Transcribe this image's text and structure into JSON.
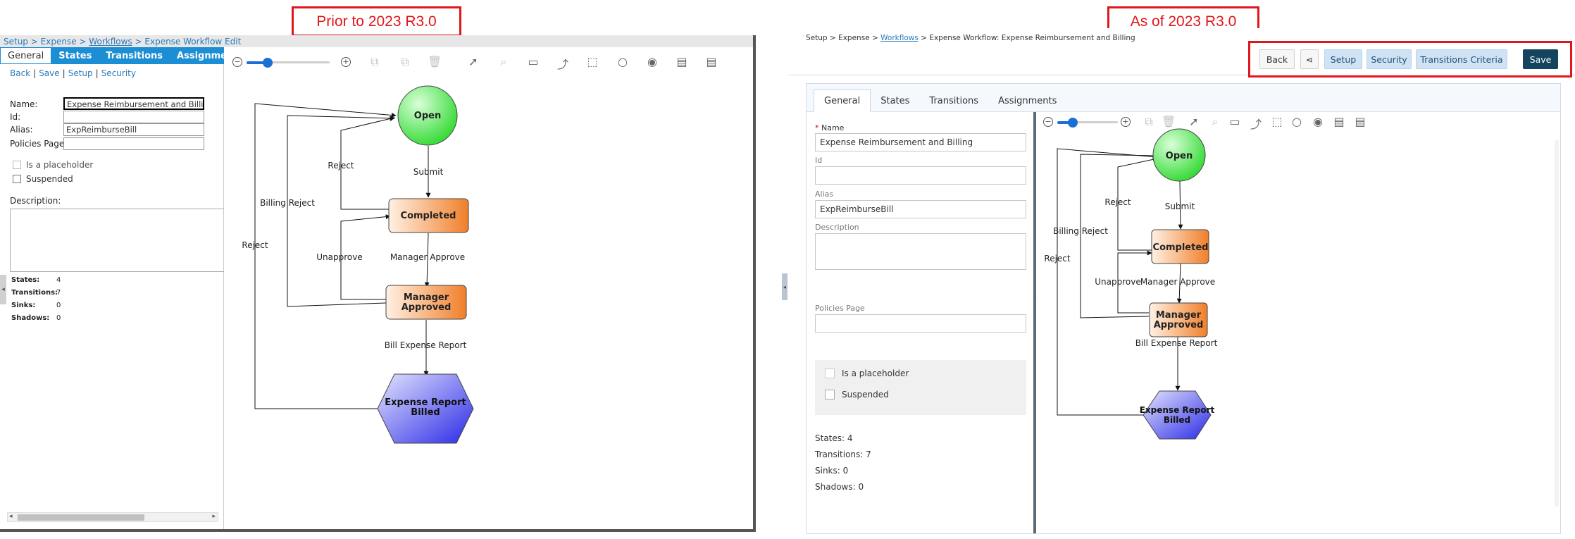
{
  "callouts": {
    "old": "Prior to 2023 R3.0",
    "new": "As of 2023 R3.0"
  },
  "old": {
    "breadcrumb": {
      "setup": "Setup",
      "sep": ">",
      "expense": "Expense",
      "workflows": "Workflows",
      "current": "Expense Workflow Edit"
    },
    "tabs": [
      "General",
      "States",
      "Transitions",
      "Assignments"
    ],
    "actions": [
      "Back",
      "Save",
      "Setup",
      "Security"
    ],
    "fields": {
      "name_label": "Name:",
      "name_value": "Expense Reimbursement and Billing",
      "id_label": "Id:",
      "id_value": "",
      "alias_label": "Alias:",
      "alias_value": "ExpReimburseBill",
      "policies_label": "Policies Page:",
      "policies_value": ""
    },
    "checks": {
      "placeholder": "Is a placeholder",
      "suspended": "Suspended"
    },
    "description_label": "Description:",
    "stats": [
      {
        "label": "States:",
        "value": "4"
      },
      {
        "label": "Transitions:",
        "value": "7"
      },
      {
        "label": "Sinks:",
        "value": "0"
      },
      {
        "label": "Shadows:",
        "value": "0"
      }
    ]
  },
  "new": {
    "breadcrumb": {
      "setup": "Setup",
      "sep": ">",
      "expense": "Expense",
      "workflows": "Workflows",
      "current": "Expense Workflow: Expense Reimbursement and Billing"
    },
    "buttons": {
      "back": "Back",
      "setup": "Setup",
      "security": "Security",
      "transitions_criteria": "Transitions Criteria",
      "save": "Save"
    },
    "tabs": [
      "General",
      "States",
      "Transitions",
      "Assignments"
    ],
    "fields": {
      "name_label": "Name",
      "name_value": "Expense Reimbursement and Billing",
      "id_label": "Id",
      "id_value": "",
      "alias_label": "Alias",
      "alias_value": "ExpReimburseBill",
      "description_label": "Description",
      "policies_label": "Policies Page",
      "policies_value": ""
    },
    "checks": {
      "placeholder": "Is a placeholder",
      "suspended": "Suspended"
    },
    "stats": [
      "States: 4",
      "Transitions: 7",
      "Sinks: 0",
      "Shadows: 0"
    ]
  },
  "workflow": {
    "states": {
      "open": "Open",
      "completed": "Completed",
      "manager_l1": "Manager",
      "manager_l2": "Approved",
      "billed_l1": "Expense Report",
      "billed_l2": "Billed"
    },
    "transitions": {
      "submit": "Submit",
      "reject": "Reject",
      "billing_reject": "Billing Reject",
      "unapprove": "Unapprove",
      "manager_approve": "Manager Approve",
      "bill": "Bill Expense Report"
    },
    "colors": {
      "open": "#3ddc3d",
      "completed": "#f07f2a",
      "billed": "#2a2ae6"
    }
  },
  "zoom": {
    "level": 0.25
  }
}
